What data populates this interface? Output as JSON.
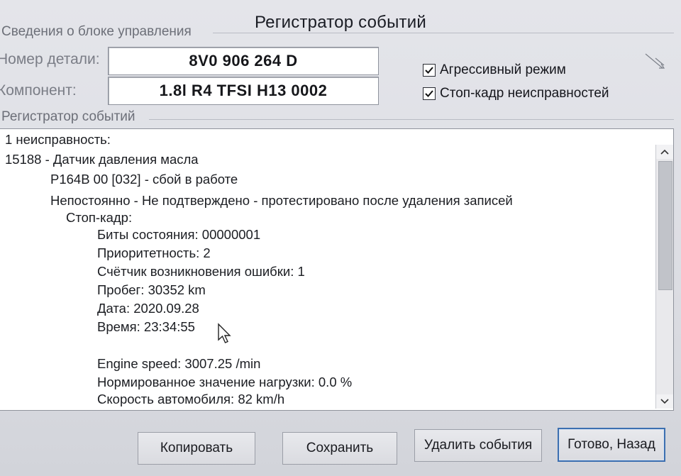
{
  "window": {
    "title": "Регистратор событий"
  },
  "control_unit": {
    "group_label": "Сведения о блоке управления",
    "part_number_label": "Номер детали:",
    "part_number": "8V0 906 264 D",
    "component_label": "Компонент:",
    "component": "1.8l R4 TFSI  H13 0002"
  },
  "options": {
    "aggressive_mode": {
      "label": "Агрессивный режим",
      "checked": true
    },
    "freeze_frame": {
      "label": "Стоп-кадр неисправностей",
      "checked": true
    }
  },
  "event_log": {
    "group_label": "Регистратор событий",
    "lines": [
      "1 неисправность:",
      "15188 - Датчик давления масла",
      "P164B 00 [032] - сбой в работе",
      "Непостоянно - Не подтверждено - протестировано после удаления записей",
      "Стоп-кадр:",
      "Биты состояния: 00000001",
      "Приоритетность: 2",
      "Счётчик возникновения ошибки: 1",
      "Пробег: 30352 km",
      "Дата: 2020.09.28",
      "Время: 23:34:55",
      "Engine speed: 3007.25 /min",
      "Нормированное значение нагрузки: 0.0 %",
      "Скорость автомобиля: 82 km/h"
    ]
  },
  "buttons": {
    "copy": "Копировать",
    "save": "Сохранить",
    "delete_events": "Удалить события",
    "done_back": "Готово, Назад"
  },
  "icons": {
    "resize_grip": "resize-grip-icon",
    "scroll_up": "chevron-up-icon",
    "scroll_down": "chevron-down-icon",
    "cursor": "mouse-pointer-icon",
    "checkbox": "checkmark-icon"
  }
}
